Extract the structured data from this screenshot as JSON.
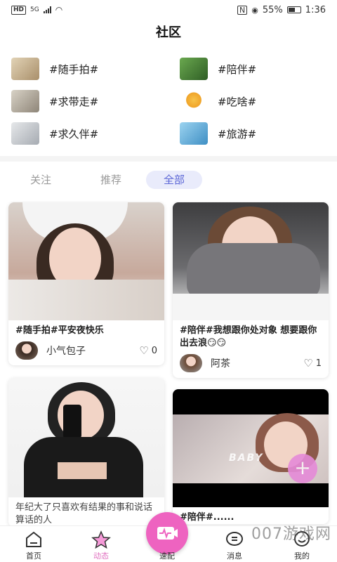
{
  "status_bar": {
    "hd": "HD",
    "network": "5G",
    "battery": "55%",
    "time": "1:36"
  },
  "header": {
    "title": "社区"
  },
  "topics": [
    {
      "label": "#随手拍#",
      "thumb_color": "#c9b79a"
    },
    {
      "label": "#陪伴#",
      "thumb_color": "#4f8a3e"
    },
    {
      "label": "#求带走#",
      "thumb_color": "#b9b2a6"
    },
    {
      "label": "#吃啥#",
      "thumb_color": "#f0b341"
    },
    {
      "label": "#求久伴#",
      "thumb_color": "#c8ccd2"
    },
    {
      "label": "#旅游#",
      "thumb_color": "#6fb6e0"
    }
  ],
  "tabs": [
    {
      "label": "关注",
      "active": false
    },
    {
      "label": "推荐",
      "active": false
    },
    {
      "label": "全部",
      "active": true
    }
  ],
  "posts": [
    {
      "text": "#随手拍#平安夜快乐",
      "author": "小气包子",
      "likes": "0"
    },
    {
      "text": "#陪伴#我想跟你处对象 想要跟你出去浪😏😏",
      "author": "阿茶",
      "likes": "1"
    },
    {
      "text": "年纪大了只喜欢有结果的事和说话算话的人",
      "author": "",
      "likes": ""
    },
    {
      "text": "#陪伴#......",
      "author": "",
      "likes": "",
      "photo_caption": "BABY"
    }
  ],
  "bottom_nav": {
    "items": [
      {
        "label": "首页",
        "icon": "home-icon"
      },
      {
        "label": "动态",
        "icon": "star-icon"
      },
      {
        "label": "速配",
        "icon": "pulse-icon"
      },
      {
        "label": "消息",
        "icon": "chat-icon"
      },
      {
        "label": "我的",
        "icon": "profile-icon"
      }
    ]
  },
  "watermark": "007游戏网",
  "colors": {
    "accent": "#5b66d6",
    "pink": "#ee63c0",
    "active_nav": "#e06fbf"
  }
}
